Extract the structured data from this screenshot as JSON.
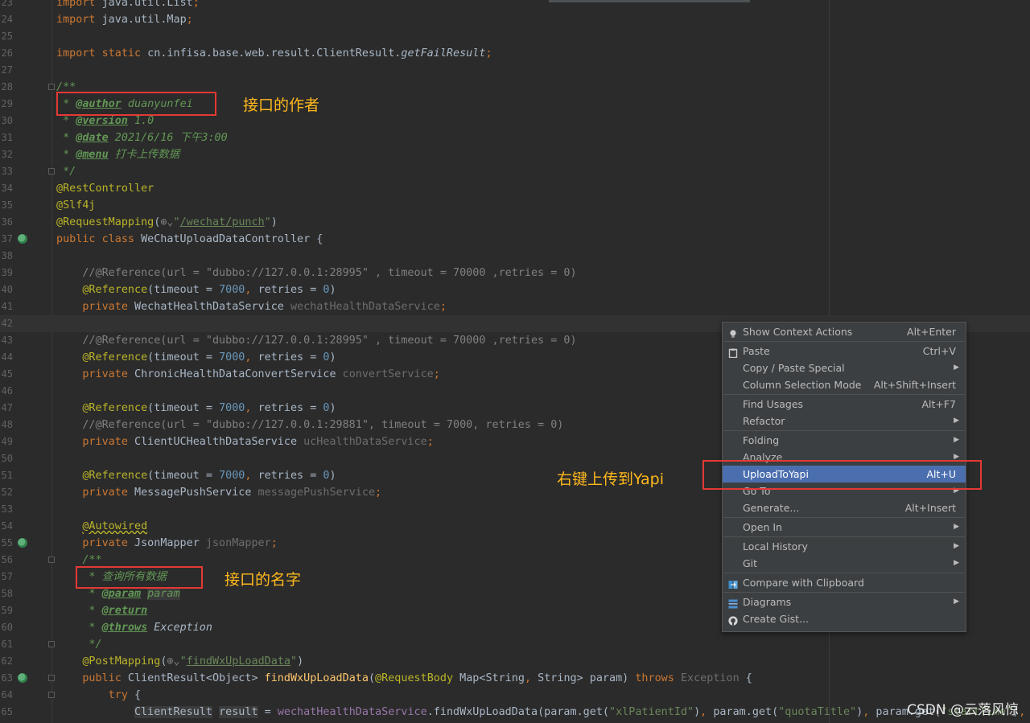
{
  "lines": [
    {
      "n": "23",
      "html": "<span class=\"kw\">import</span> java.util.List<span class=\"kw\">;</span>"
    },
    {
      "n": "24",
      "html": "<span class=\"kw\">import</span> java.util.Map<span class=\"kw\">;</span>"
    },
    {
      "n": "25",
      "html": ""
    },
    {
      "n": "26",
      "html": "<span class=\"kw\">import static</span> cn.infisa.base.web.result.ClientResult.<span class=\"static\">getFailResult</span><span class=\"kw\">;</span>"
    },
    {
      "n": "27",
      "html": ""
    },
    {
      "n": "28",
      "html": "<span class=\"doc\">/**</span>"
    },
    {
      "n": "29",
      "html": "<span class=\"doc\"> * </span><span class=\"tag\">@author</span><span class=\"doc\"> duanyunfei</span>"
    },
    {
      "n": "30",
      "html": "<span class=\"doc\"> * </span><span class=\"tag\">@version</span><span class=\"doc\"> 1.0</span>"
    },
    {
      "n": "31",
      "html": "<span class=\"doc\"> * </span><span class=\"tag\">@date</span><span class=\"doc\"> 2021/6/16 下午3:00</span>"
    },
    {
      "n": "32",
      "html": "<span class=\"doc\"> * </span><span class=\"tag\">@menu</span><span class=\"doc\"> 打卡上传数据</span>"
    },
    {
      "n": "33",
      "html": "<span class=\"doc\"> */</span>"
    },
    {
      "n": "34",
      "html": "<span class=\"ann\">@RestController</span>"
    },
    {
      "n": "35",
      "html": "<span class=\"ann\">@Slf4j</span>"
    },
    {
      "n": "36",
      "html": "<span class=\"ann\">@RequestMapping</span>(<span class=\"hint\">⊕⌄</span><span class=\"str\">\"</span><span class=\"strlink\">/wechat/punch</span><span class=\"str\">\"</span>)"
    },
    {
      "n": "37",
      "html": "<span class=\"kw\">public class</span> WeChatUploadDataController {"
    },
    {
      "n": "38",
      "html": ""
    },
    {
      "n": "39",
      "html": "    <span class=\"cmt\">//@Reference(url = \"dubbo://127.0.0.1:28995\" , timeout = 70000 ,retries = 0)</span>"
    },
    {
      "n": "40",
      "html": "    <span class=\"ann\">@Reference</span>(timeout = <span class=\"num\">7000</span><span class=\"kw\">,</span> retries = <span class=\"num\">0</span>)"
    },
    {
      "n": "41",
      "html": "    <span class=\"kw\">private</span> WechatHealthDataService <span class=\"unused\">wechatHealthDataService</span><span class=\"kw\">;</span>"
    },
    {
      "n": "42",
      "html": ""
    },
    {
      "n": "43",
      "html": "    <span class=\"cmt\">//@Reference(url = \"dubbo://127.0.0.1:28995\" , timeout = 70000 ,retries = 0)</span>"
    },
    {
      "n": "44",
      "html": "    <span class=\"ann\">@Reference</span>(timeout = <span class=\"num\">7000</span><span class=\"kw\">,</span> retries = <span class=\"num\">0</span>)"
    },
    {
      "n": "45",
      "html": "    <span class=\"kw\">private</span> ChronicHealthDataConvertService <span class=\"unused\">convertService</span><span class=\"kw\">;</span>"
    },
    {
      "n": "46",
      "html": ""
    },
    {
      "n": "47",
      "html": "    <span class=\"ann\">@Reference</span>(timeout = <span class=\"num\">7000</span><span class=\"kw\">,</span> retries = <span class=\"num\">0</span>)"
    },
    {
      "n": "48",
      "html": "    <span class=\"cmt\">//@Reference(url = \"dubbo://127.0.0.1:29881\", timeout = 7000, retries = 0)</span>"
    },
    {
      "n": "49",
      "html": "    <span class=\"kw\">private</span> ClientUCHealthDataService <span class=\"unused\">ucHealthDataService</span><span class=\"kw\">;</span>"
    },
    {
      "n": "50",
      "html": ""
    },
    {
      "n": "51",
      "html": "    <span class=\"ann\">@Reference</span>(timeout = <span class=\"num\">7000</span><span class=\"kw\">,</span> retries = <span class=\"num\">0</span>)"
    },
    {
      "n": "52",
      "html": "    <span class=\"kw\">private</span> MessagePushService <span class=\"unused\">messagePushService</span><span class=\"kw\">;</span>"
    },
    {
      "n": "53",
      "html": ""
    },
    {
      "n": "54",
      "html": "    <span class=\"ann\" style=\"text-decoration:underline wavy #bbb529\">@Autowired</span>"
    },
    {
      "n": "55",
      "html": "    <span class=\"kw\">private</span> JsonMapper <span class=\"unused\">jsonMapper</span><span class=\"kw\">;</span>"
    },
    {
      "n": "56",
      "html": "    <span class=\"doc\">/**</span>"
    },
    {
      "n": "57",
      "html": "<span class=\"doc\">     * 查询所有数据</span>"
    },
    {
      "n": "58",
      "html": "<span class=\"doc\">     * </span><span class=\"tag\">@param</span><span class=\"doc\"> </span><span class=\"doc hl2\">param</span>"
    },
    {
      "n": "59",
      "html": "<span class=\"doc\">     * </span><span class=\"tag\">@return</span>"
    },
    {
      "n": "60",
      "html": "<span class=\"doc\">     * </span><span class=\"tag\">@throws</span><span class=\"doc\" style=\"color:#a9b7c6\"> Exception</span>"
    },
    {
      "n": "61",
      "html": "<span class=\"doc\">     */</span>"
    },
    {
      "n": "62",
      "html": "    <span class=\"ann\">@PostMapping</span>(<span class=\"hint\">⊕⌄</span><span class=\"str\">\"</span><span class=\"strlink\">findWxUpLoadData</span><span class=\"str\">\"</span>)"
    },
    {
      "n": "63",
      "html": "    <span class=\"kw\">public</span> ClientResult&lt;Object&gt; <span class=\"fn\">findWxUpLoadData</span>(<span class=\"ann\">@RequestBody</span> Map&lt;String<span class=\"kw\">,</span> String&gt; param) <span class=\"kw\">throws</span> <span class=\"unused\">Exception</span> {"
    },
    {
      "n": "64",
      "html": "        <span class=\"kw\">try</span> {"
    },
    {
      "n": "65",
      "html": "            <span class=\"hl2\">ClientResult</span> <span class=\"hl2\">result</span> = <span class=\"fld\">wechatHealthDataService</span>.findWxUpLoadData(param.get(<span class=\"str\">\"xlPatientId\"</span>)<span class=\"kw\">,</span> param.get(<span class=\"str\">\"quotaTitle\"</span>)<span class=\"kw\">,</span> param.get(<span class=\"str\">\"startTime\"</span>)<span class=\"kw\">,</span> param"
    }
  ],
  "callouts": {
    "author": "接口的作者",
    "name": "接口的名字",
    "upload": "右键上传到Yapi"
  },
  "watermark": "CSDN @云落风惊",
  "menu": [
    {
      "label": "Show Context Actions",
      "shortcut": "Alt+Enter",
      "icon": "lightbulb-icon"
    },
    {
      "sep": true
    },
    {
      "label": "Paste",
      "shortcut": "Ctrl+V",
      "icon": "clipboard-icon"
    },
    {
      "label": "Copy / Paste Special",
      "submenu": true
    },
    {
      "label": "Column Selection Mode",
      "shortcut": "Alt+Shift+Insert"
    },
    {
      "sep": true
    },
    {
      "label": "Find Usages",
      "shortcut": "Alt+F7"
    },
    {
      "label": "Refactor",
      "submenu": true
    },
    {
      "sep": true
    },
    {
      "label": "Folding",
      "submenu": true
    },
    {
      "label": "Analyze",
      "submenu": true
    },
    {
      "label": "UploadToYapi",
      "shortcut": "Alt+U",
      "selected": true
    },
    {
      "label": "Go To",
      "submenu": true
    },
    {
      "label": "Generate...",
      "shortcut": "Alt+Insert"
    },
    {
      "sep": true
    },
    {
      "label": "Open In",
      "submenu": true
    },
    {
      "sep": true
    },
    {
      "label": "Local History",
      "submenu": true
    },
    {
      "label": "Git",
      "submenu": true
    },
    {
      "sep": true
    },
    {
      "label": "Compare with Clipboard",
      "icon": "compare-icon"
    },
    {
      "sep": true
    },
    {
      "label": "Diagrams",
      "submenu": true,
      "icon": "diagram-icon"
    },
    {
      "label": "Create Gist...",
      "icon": "github-icon"
    }
  ],
  "colors": {
    "selection": "#4b6eaf",
    "callout": "#ffb81c",
    "redbox": "#e53935"
  }
}
